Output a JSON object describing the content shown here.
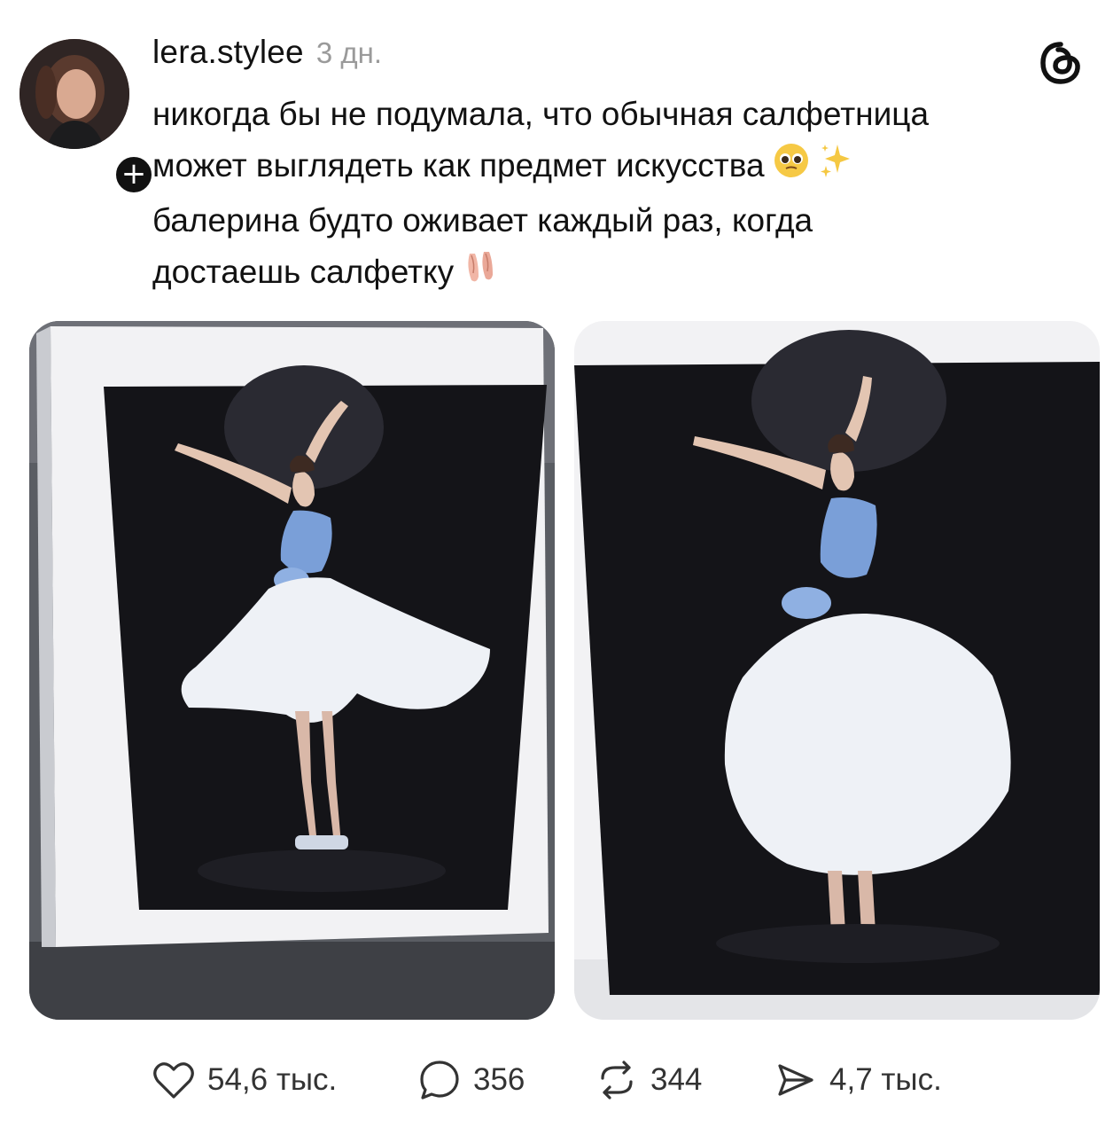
{
  "post": {
    "username": "lera.stylee",
    "timestamp": "3 дн.",
    "text_lines": [
      "никогда бы не подумала, что обычная салфетница",
      "может выглядеть как предмет искусства",
      "балерина будто оживает каждый раз, когда",
      "достаешь салфетку"
    ],
    "emojis": [
      "pleading-face-emoji",
      "sparkles-emoji",
      "ballet-shoes-emoji"
    ]
  },
  "avatar": {
    "follow_symbol": "+"
  },
  "images": [
    {
      "name": "ballerina-napkin-holder-photo-1",
      "colors": {
        "frame": "#f2f2f4",
        "panel": "#141418",
        "bodice": "#7a9fd8",
        "skirt": "#eef1f6"
      }
    },
    {
      "name": "ballerina-napkin-holder-photo-2",
      "colors": {
        "frame": "#f2f2f4",
        "panel": "#141418",
        "bodice": "#7a9fd8",
        "skirt": "#eef1f6"
      }
    }
  ],
  "actions": {
    "likes": "54,6 тыс.",
    "comments": "356",
    "reposts": "344",
    "shares": "4,7 тыс."
  },
  "icons": {
    "like": "heart-icon",
    "comment": "comment-bubble-icon",
    "repost": "repost-icon",
    "share": "send-icon",
    "brand": "threads-logo-icon"
  }
}
